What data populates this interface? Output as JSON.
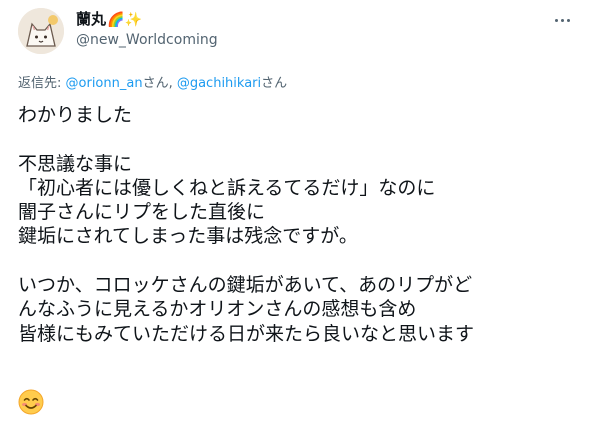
{
  "author": {
    "display_name": "蘭丸",
    "name_emojis": "🌈✨",
    "handle": "@new_Worldcoming",
    "avatar_icon": "cat-avatar-icon"
  },
  "reply": {
    "prefix": "返信先: ",
    "mention1": "@orionn_an",
    "sep1": "さん, ",
    "mention2": "@gachihikari",
    "sep2": "さん"
  },
  "tweet": {
    "lines": [
      "わかりました",
      "",
      "不思議な事に",
      "「初心者には優しくねと訴えるてるだけ」なのに",
      "闇子さんにリプをした直後に",
      "鍵垢にされてしまった事は残念ですが。",
      "",
      "いつか、コロッケさんの鍵垢があいて、あのリプがど",
      "んなふうに見えるかオリオンさんの感想も含め",
      "皆様にもみていただける日が来たら良いなと思います"
    ],
    "trailing_emoji": "smiling-face-emoji"
  },
  "colors": {
    "text": "#0f1419",
    "secondary": "#536471",
    "link": "#1d9bf0"
  }
}
